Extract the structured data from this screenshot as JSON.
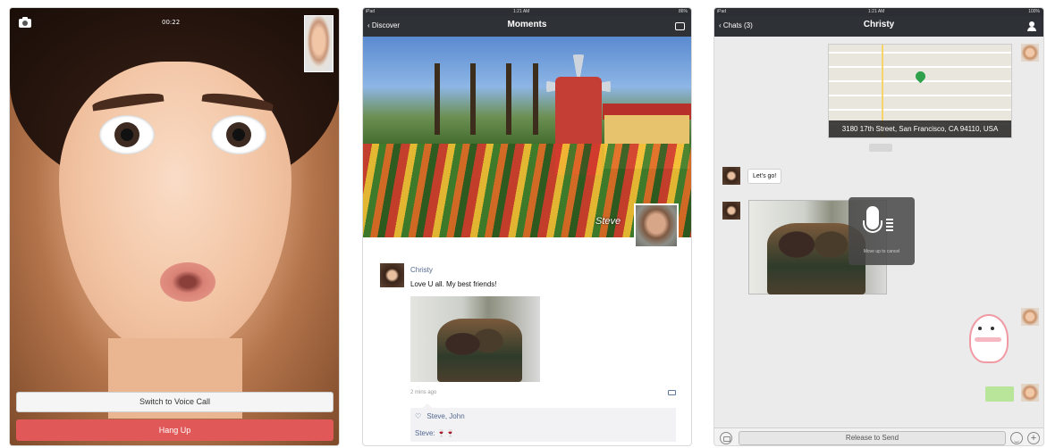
{
  "video_call": {
    "timer": "00:22",
    "voice_button": "Switch to Voice Call",
    "hangup_button": "Hang Up",
    "colors": {
      "hangup": "#e05858"
    }
  },
  "moments": {
    "status": {
      "carrier": "iPad",
      "time": "1:21 AM",
      "battery": "86%"
    },
    "nav": {
      "back": "Discover",
      "title": "Moments"
    },
    "cover_name": "Steve",
    "post": {
      "author": "Christy",
      "text": "Love U all. My best friends!",
      "time": "2 mins ago",
      "likes": "Steve, John",
      "comment_author": "Steve:",
      "comment_text": "🍷🍷"
    }
  },
  "chat": {
    "status": {
      "carrier": "iPad",
      "time": "1:21 AM",
      "battery": "100%"
    },
    "nav": {
      "back": "Chats (3)",
      "title": "Christy"
    },
    "map_address": "3180 17th Street, San Francisco, CA 94110, USA",
    "message": "Let's go!",
    "record_hint": "Move up to cancel",
    "input_button": "Release to Send"
  }
}
